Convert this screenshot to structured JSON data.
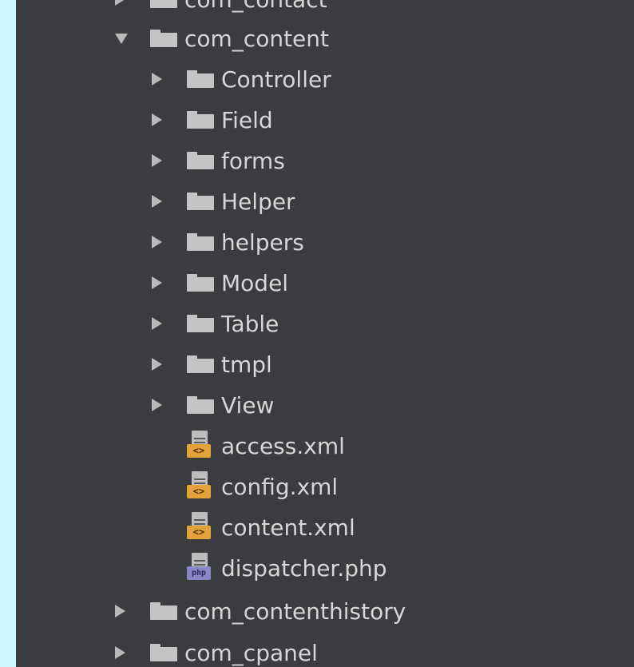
{
  "tree": {
    "items": [
      {
        "label": "com_contact",
        "kind": "folder",
        "expanded": false
      },
      {
        "label": "com_content",
        "kind": "folder",
        "expanded": true
      },
      {
        "label": "Controller",
        "kind": "folder",
        "expanded": false
      },
      {
        "label": "Field",
        "kind": "folder",
        "expanded": false
      },
      {
        "label": "forms",
        "kind": "folder",
        "expanded": false
      },
      {
        "label": "Helper",
        "kind": "folder",
        "expanded": false
      },
      {
        "label": "helpers",
        "kind": "folder",
        "expanded": false
      },
      {
        "label": "Model",
        "kind": "folder",
        "expanded": false
      },
      {
        "label": "Table",
        "kind": "folder",
        "expanded": false
      },
      {
        "label": "tmpl",
        "kind": "folder",
        "expanded": false
      },
      {
        "label": "View",
        "kind": "folder",
        "expanded": false
      },
      {
        "label": "access.xml",
        "kind": "file",
        "filetype": "xml"
      },
      {
        "label": "config.xml",
        "kind": "file",
        "filetype": "xml"
      },
      {
        "label": "content.xml",
        "kind": "file",
        "filetype": "xml"
      },
      {
        "label": "dispatcher.php",
        "kind": "file",
        "filetype": "php"
      },
      {
        "label": "com_contenthistory",
        "kind": "folder",
        "expanded": false
      },
      {
        "label": "com_cpanel",
        "kind": "folder",
        "expanded": false
      }
    ],
    "file_badges": {
      "xml": "<>",
      "php": "php"
    }
  }
}
